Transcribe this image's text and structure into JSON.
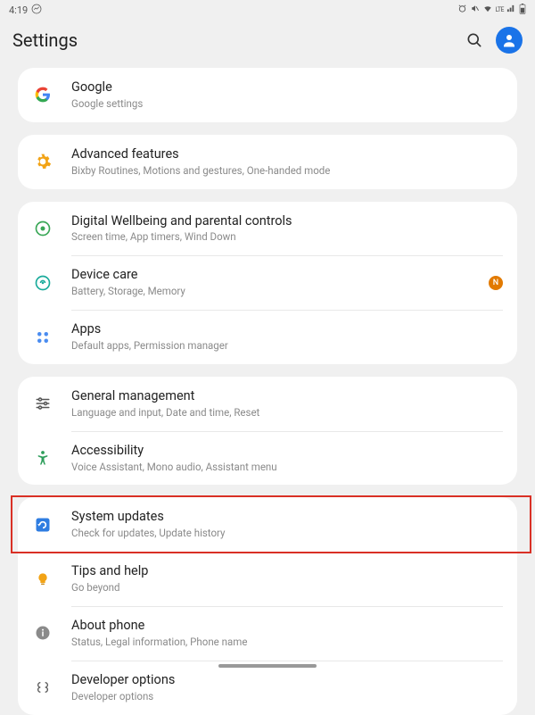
{
  "status": {
    "time": "4:19",
    "lte_label": "LTE"
  },
  "header": {
    "title": "Settings"
  },
  "cards": [
    {
      "rows": [
        {
          "icon": "google-icon",
          "title": "Google",
          "sub": "Google settings"
        }
      ]
    },
    {
      "rows": [
        {
          "icon": "advanced-icon",
          "title": "Advanced features",
          "sub": "Bixby Routines, Motions and gestures, One-handed mode"
        }
      ]
    },
    {
      "rows": [
        {
          "icon": "wellbeing-icon",
          "title": "Digital Wellbeing and parental controls",
          "sub": "Screen time, App timers, Wind Down"
        },
        {
          "icon": "device-care-icon",
          "title": "Device care",
          "sub": "Battery, Storage, Memory",
          "badge": "N"
        },
        {
          "icon": "apps-icon",
          "title": "Apps",
          "sub": "Default apps, Permission manager"
        }
      ]
    },
    {
      "rows": [
        {
          "icon": "general-icon",
          "title": "General management",
          "sub": "Language and input, Date and time, Reset"
        },
        {
          "icon": "accessibility-icon",
          "title": "Accessibility",
          "sub": "Voice Assistant, Mono audio, Assistant menu"
        }
      ]
    },
    {
      "rows": [
        {
          "icon": "updates-icon",
          "title": "System updates",
          "sub": "Check for updates, Update history",
          "highlight": true
        },
        {
          "icon": "tips-icon",
          "title": "Tips and help",
          "sub": "Go beyond"
        },
        {
          "icon": "about-icon",
          "title": "About phone",
          "sub": "Status, Legal information, Phone name"
        },
        {
          "icon": "developer-icon",
          "title": "Developer options",
          "sub": "Developer options"
        }
      ]
    }
  ]
}
